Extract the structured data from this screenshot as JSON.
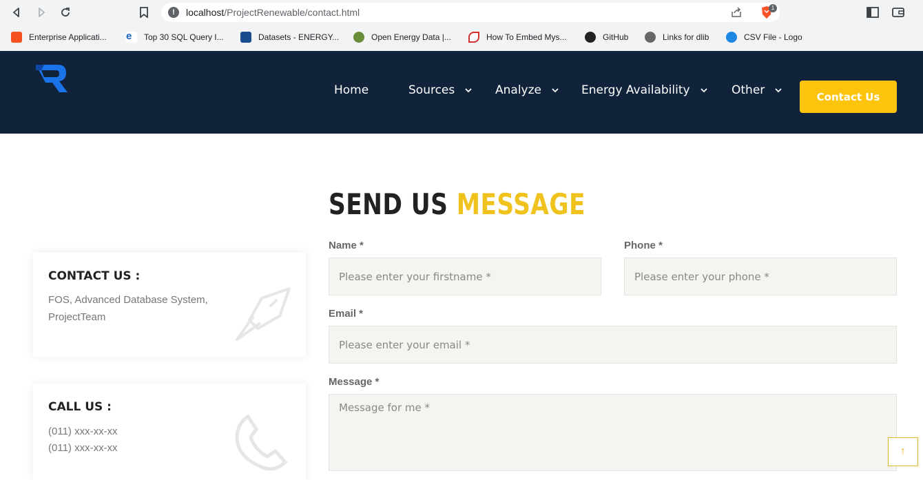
{
  "browser": {
    "url_host": "localhost",
    "url_path": "/ProjectRenewable/contact.html",
    "brave_badge": "1",
    "bookmarks": [
      {
        "label": "Enterprise Applicati...",
        "color": "#f4511e"
      },
      {
        "label": "Top 30 SQL Query I...",
        "color": "#1565c0"
      },
      {
        "label": "Datasets - ENERGY...",
        "color": "#1a4b8c"
      },
      {
        "label": "Open Energy Data |...",
        "color": "#6a8d3a"
      },
      {
        "label": "How To Embed Mys...",
        "color": "#d32f2f"
      },
      {
        "label": "GitHub",
        "color": "#222222"
      },
      {
        "label": "Links for dlib",
        "color": "#555555"
      },
      {
        "label": "CSV File - Logo",
        "color": "#1e88e5"
      }
    ]
  },
  "nav": {
    "items": [
      {
        "label": "Home"
      },
      {
        "label": "Sources"
      },
      {
        "label": "Analyze"
      },
      {
        "label": "Energy Availability"
      },
      {
        "label": "Other"
      }
    ],
    "cta": "Contact Us"
  },
  "form": {
    "heading_a": "SEND US",
    "heading_b": "MESSAGE",
    "name_label": "Name *",
    "name_placeholder": "Please enter your firstname *",
    "phone_label": "Phone *",
    "phone_placeholder": "Please enter your phone *",
    "email_label": "Email *",
    "email_placeholder": "Please enter your email *",
    "message_label": "Message *",
    "message_placeholder": "Message for me *"
  },
  "cards": {
    "contact": {
      "title": "CONTACT US :",
      "line1": "FOS, Advanced Database System,",
      "line2": "ProjectTeam"
    },
    "call": {
      "title": "CALL US :",
      "line1": "(011) xxx-xx-xx",
      "line2": "(011) xxx-xx-xx"
    }
  },
  "scroll_top": "↑",
  "colors": {
    "header_bg": "#10233a",
    "accent": "#fcc40c",
    "logo_blue": "#1a73e8"
  }
}
